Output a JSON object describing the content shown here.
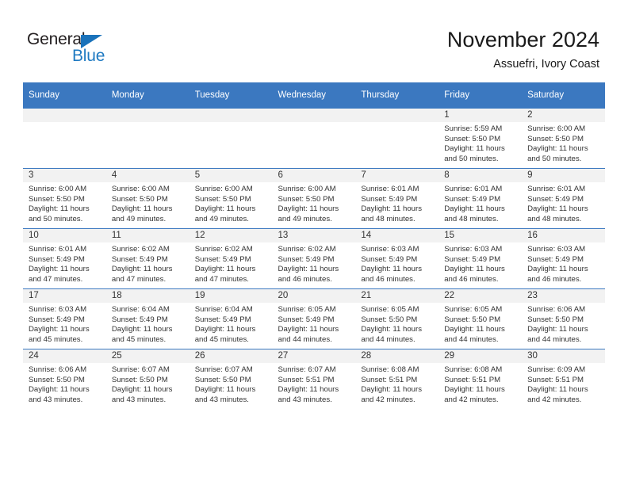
{
  "brand": {
    "name_part1": "General",
    "name_part2": "Blue",
    "triangle_color": "#1a72ba",
    "blue_color": "#1f7ac2"
  },
  "header": {
    "month_title": "November 2024",
    "location": "Assuefri, Ivory Coast"
  },
  "theme": {
    "header_blue": "#3b78c0",
    "daynum_band": "#f2f2f2",
    "text": "#333333"
  },
  "weekdays": [
    "Sunday",
    "Monday",
    "Tuesday",
    "Wednesday",
    "Thursday",
    "Friday",
    "Saturday"
  ],
  "labels": {
    "sunrise_prefix": "Sunrise:",
    "sunset_prefix": "Sunset:",
    "daylight_prefix": "Daylight:"
  },
  "weeks": [
    [
      {
        "day": "",
        "empty": true
      },
      {
        "day": "",
        "empty": true
      },
      {
        "day": "",
        "empty": true
      },
      {
        "day": "",
        "empty": true
      },
      {
        "day": "",
        "empty": true
      },
      {
        "day": "1",
        "sunrise": "Sunrise: 5:59 AM",
        "sunset": "Sunset: 5:50 PM",
        "daylight_l1": "Daylight: 11 hours",
        "daylight_l2": "and 50 minutes."
      },
      {
        "day": "2",
        "sunrise": "Sunrise: 6:00 AM",
        "sunset": "Sunset: 5:50 PM",
        "daylight_l1": "Daylight: 11 hours",
        "daylight_l2": "and 50 minutes."
      }
    ],
    [
      {
        "day": "3",
        "sunrise": "Sunrise: 6:00 AM",
        "sunset": "Sunset: 5:50 PM",
        "daylight_l1": "Daylight: 11 hours",
        "daylight_l2": "and 50 minutes."
      },
      {
        "day": "4",
        "sunrise": "Sunrise: 6:00 AM",
        "sunset": "Sunset: 5:50 PM",
        "daylight_l1": "Daylight: 11 hours",
        "daylight_l2": "and 49 minutes."
      },
      {
        "day": "5",
        "sunrise": "Sunrise: 6:00 AM",
        "sunset": "Sunset: 5:50 PM",
        "daylight_l1": "Daylight: 11 hours",
        "daylight_l2": "and 49 minutes."
      },
      {
        "day": "6",
        "sunrise": "Sunrise: 6:00 AM",
        "sunset": "Sunset: 5:50 PM",
        "daylight_l1": "Daylight: 11 hours",
        "daylight_l2": "and 49 minutes."
      },
      {
        "day": "7",
        "sunrise": "Sunrise: 6:01 AM",
        "sunset": "Sunset: 5:49 PM",
        "daylight_l1": "Daylight: 11 hours",
        "daylight_l2": "and 48 minutes."
      },
      {
        "day": "8",
        "sunrise": "Sunrise: 6:01 AM",
        "sunset": "Sunset: 5:49 PM",
        "daylight_l1": "Daylight: 11 hours",
        "daylight_l2": "and 48 minutes."
      },
      {
        "day": "9",
        "sunrise": "Sunrise: 6:01 AM",
        "sunset": "Sunset: 5:49 PM",
        "daylight_l1": "Daylight: 11 hours",
        "daylight_l2": "and 48 minutes."
      }
    ],
    [
      {
        "day": "10",
        "sunrise": "Sunrise: 6:01 AM",
        "sunset": "Sunset: 5:49 PM",
        "daylight_l1": "Daylight: 11 hours",
        "daylight_l2": "and 47 minutes."
      },
      {
        "day": "11",
        "sunrise": "Sunrise: 6:02 AM",
        "sunset": "Sunset: 5:49 PM",
        "daylight_l1": "Daylight: 11 hours",
        "daylight_l2": "and 47 minutes."
      },
      {
        "day": "12",
        "sunrise": "Sunrise: 6:02 AM",
        "sunset": "Sunset: 5:49 PM",
        "daylight_l1": "Daylight: 11 hours",
        "daylight_l2": "and 47 minutes."
      },
      {
        "day": "13",
        "sunrise": "Sunrise: 6:02 AM",
        "sunset": "Sunset: 5:49 PM",
        "daylight_l1": "Daylight: 11 hours",
        "daylight_l2": "and 46 minutes."
      },
      {
        "day": "14",
        "sunrise": "Sunrise: 6:03 AM",
        "sunset": "Sunset: 5:49 PM",
        "daylight_l1": "Daylight: 11 hours",
        "daylight_l2": "and 46 minutes."
      },
      {
        "day": "15",
        "sunrise": "Sunrise: 6:03 AM",
        "sunset": "Sunset: 5:49 PM",
        "daylight_l1": "Daylight: 11 hours",
        "daylight_l2": "and 46 minutes."
      },
      {
        "day": "16",
        "sunrise": "Sunrise: 6:03 AM",
        "sunset": "Sunset: 5:49 PM",
        "daylight_l1": "Daylight: 11 hours",
        "daylight_l2": "and 46 minutes."
      }
    ],
    [
      {
        "day": "17",
        "sunrise": "Sunrise: 6:03 AM",
        "sunset": "Sunset: 5:49 PM",
        "daylight_l1": "Daylight: 11 hours",
        "daylight_l2": "and 45 minutes."
      },
      {
        "day": "18",
        "sunrise": "Sunrise: 6:04 AM",
        "sunset": "Sunset: 5:49 PM",
        "daylight_l1": "Daylight: 11 hours",
        "daylight_l2": "and 45 minutes."
      },
      {
        "day": "19",
        "sunrise": "Sunrise: 6:04 AM",
        "sunset": "Sunset: 5:49 PM",
        "daylight_l1": "Daylight: 11 hours",
        "daylight_l2": "and 45 minutes."
      },
      {
        "day": "20",
        "sunrise": "Sunrise: 6:05 AM",
        "sunset": "Sunset: 5:49 PM",
        "daylight_l1": "Daylight: 11 hours",
        "daylight_l2": "and 44 minutes."
      },
      {
        "day": "21",
        "sunrise": "Sunrise: 6:05 AM",
        "sunset": "Sunset: 5:50 PM",
        "daylight_l1": "Daylight: 11 hours",
        "daylight_l2": "and 44 minutes."
      },
      {
        "day": "22",
        "sunrise": "Sunrise: 6:05 AM",
        "sunset": "Sunset: 5:50 PM",
        "daylight_l1": "Daylight: 11 hours",
        "daylight_l2": "and 44 minutes."
      },
      {
        "day": "23",
        "sunrise": "Sunrise: 6:06 AM",
        "sunset": "Sunset: 5:50 PM",
        "daylight_l1": "Daylight: 11 hours",
        "daylight_l2": "and 44 minutes."
      }
    ],
    [
      {
        "day": "24",
        "sunrise": "Sunrise: 6:06 AM",
        "sunset": "Sunset: 5:50 PM",
        "daylight_l1": "Daylight: 11 hours",
        "daylight_l2": "and 43 minutes."
      },
      {
        "day": "25",
        "sunrise": "Sunrise: 6:07 AM",
        "sunset": "Sunset: 5:50 PM",
        "daylight_l1": "Daylight: 11 hours",
        "daylight_l2": "and 43 minutes."
      },
      {
        "day": "26",
        "sunrise": "Sunrise: 6:07 AM",
        "sunset": "Sunset: 5:50 PM",
        "daylight_l1": "Daylight: 11 hours",
        "daylight_l2": "and 43 minutes."
      },
      {
        "day": "27",
        "sunrise": "Sunrise: 6:07 AM",
        "sunset": "Sunset: 5:51 PM",
        "daylight_l1": "Daylight: 11 hours",
        "daylight_l2": "and 43 minutes."
      },
      {
        "day": "28",
        "sunrise": "Sunrise: 6:08 AM",
        "sunset": "Sunset: 5:51 PM",
        "daylight_l1": "Daylight: 11 hours",
        "daylight_l2": "and 42 minutes."
      },
      {
        "day": "29",
        "sunrise": "Sunrise: 6:08 AM",
        "sunset": "Sunset: 5:51 PM",
        "daylight_l1": "Daylight: 11 hours",
        "daylight_l2": "and 42 minutes."
      },
      {
        "day": "30",
        "sunrise": "Sunrise: 6:09 AM",
        "sunset": "Sunset: 5:51 PM",
        "daylight_l1": "Daylight: 11 hours",
        "daylight_l2": "and 42 minutes."
      }
    ]
  ]
}
